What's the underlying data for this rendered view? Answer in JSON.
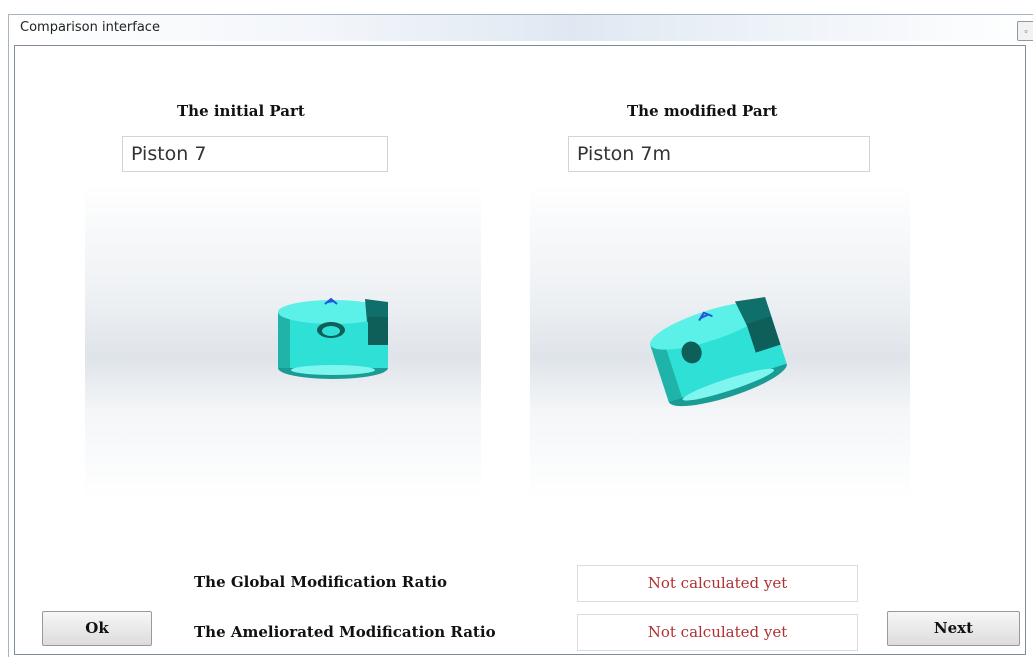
{
  "window": {
    "title": "Comparison interface",
    "control_icon": "restore-icon"
  },
  "initial": {
    "heading": "The initial Part",
    "name": "Piston 7",
    "model_icon": "piston-part-3d-icon",
    "part_color": "#2ee0d6"
  },
  "modified": {
    "heading": "The modified Part",
    "name": "Piston 7m",
    "model_icon": "piston-part-3d-icon",
    "part_color": "#2ee0d6"
  },
  "ratios": {
    "global_label": "The Global Modification Ratio",
    "global_value": "Not calculated yet",
    "ameliorated_label": "The Ameliorated Modification Ratio",
    "ameliorated_value": "Not calculated yet",
    "value_color": "#b03030"
  },
  "buttons": {
    "ok": "Ok",
    "next": "Next"
  }
}
